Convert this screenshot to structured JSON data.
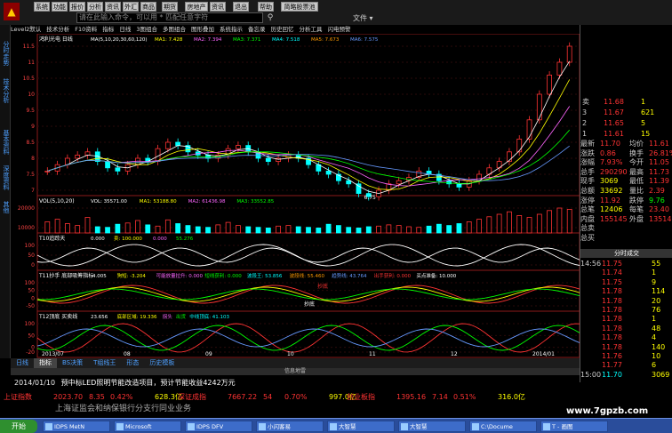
{
  "toolbar": {
    "buttons": [
      "系统",
      "功能",
      "报价",
      "分析",
      "资讯",
      "外汇",
      "商品",
      "期货",
      "房地产",
      "资讯",
      "退出",
      "帮助",
      "简略股票池"
    ],
    "search_placeholder": "请在此输入命令，可以用 * 匹配任意字符",
    "search_icon": "magnifier-icon",
    "file_menu": "文件 ▾"
  },
  "left_tabs": [
    "分时走势",
    "技术分析",
    "基本资料",
    "深度资料",
    "其他"
  ],
  "menu_bar": [
    "Level2默认",
    "技术分析",
    "F10资料",
    "指标",
    "日线",
    "3图组合",
    "多图组合",
    "图形叠加",
    "系统指示",
    "备忘录",
    "历史回忆",
    "分析工具",
    "闪电预警"
  ],
  "chart_data": [
    {
      "type": "line",
      "title": "鸿利光电 日线",
      "legend": [
        "MA(5,10,20,30,60,120)",
        "MA1: 7.428",
        "MA2: 7.394",
        "MA3: 7.371",
        "MA4: 7.518",
        "MA5: 7.673",
        "MA6: 7.575"
      ],
      "y_ticks": [
        11.5,
        11.0,
        10.5,
        10.0,
        9.5,
        9.0,
        8.5,
        8.0,
        7.5,
        7.0
      ],
      "annotations": [
        "6.75"
      ],
      "close": [
        7.6,
        7.8,
        8.0,
        8.1,
        8.2,
        7.9,
        7.7,
        7.6,
        7.8,
        8.0,
        7.9,
        8.3,
        8.5,
        8.4,
        8.2,
        8.1,
        8.0,
        8.1,
        8.3,
        8.4,
        8.2,
        8.0,
        7.9,
        8.0,
        8.1,
        8.0,
        7.8,
        7.6,
        7.5,
        7.3,
        7.2,
        6.9,
        6.8,
        7.0,
        7.2,
        7.3,
        7.4,
        7.6,
        7.5,
        7.3,
        7.2,
        7.1,
        7.3,
        7.5,
        7.7,
        7.9,
        8.2,
        8.6,
        9.2,
        10.0,
        10.6,
        11.0,
        11.5
      ]
    },
    {
      "type": "bar",
      "title": "VOL(5,10,20)",
      "legend": [
        "VOL: 35571.00",
        "MA1: 53188.80",
        "MA2: 61436.98",
        "MA3: 33552.85"
      ],
      "y_ticks": [
        20000,
        10000
      ],
      "values": [
        18,
        22,
        15,
        12,
        25,
        10,
        9,
        14,
        16,
        20,
        13,
        11,
        21,
        15,
        12,
        10,
        9,
        13,
        17,
        12,
        10,
        9,
        8,
        11,
        12,
        10,
        9,
        8,
        14,
        12,
        9,
        8,
        10,
        11,
        13,
        12,
        10,
        9,
        11,
        14,
        12,
        15,
        18,
        22,
        26,
        30,
        34,
        28,
        25,
        30,
        36,
        40,
        38
      ]
    },
    {
      "type": "line",
      "title": "T10追踪天",
      "legend": [
        "0.000",
        "卖: 100.000",
        "0.000",
        "55.276"
      ],
      "y_ticks": [
        100,
        50,
        0
      ]
    },
    {
      "type": "line",
      "title": "T11抄手 底部吸筹指标",
      "legend": [
        "-4.005",
        "狗短: -3.204",
        "可能放量拉升: 0.000",
        "短线获利: 0.000",
        "波段王: 53.856",
        "波段线: 55.460",
        "趋势线: 43.764",
        "出手获利: 0.000",
        "买点准备: 10.000"
      ],
      "y_ticks": [
        100,
        50,
        0,
        -50
      ],
      "annotations": [
        "抄底",
        "抄底"
      ]
    },
    {
      "type": "line",
      "title": "T12顶底 买卖线",
      "legend": [
        "23.656",
        "底部区域: 19.336",
        "拐头",
        "出货",
        "中线顶底: 41.103"
      ],
      "y_ticks": [
        100,
        50,
        0,
        -20
      ]
    }
  ],
  "x_axis_labels": [
    "2013/07",
    "08",
    "09",
    "10",
    "11",
    "12",
    "2014/01"
  ],
  "right_panel": {
    "ask_rows": [
      {
        "label": "卖",
        "price": "11.68",
        "vol": "1"
      },
      {
        "label": "3",
        "price": "11.67",
        "vol": "621"
      },
      {
        "label": "2",
        "price": "11.65",
        "vol": "5"
      },
      {
        "label": "1",
        "price": "11.61",
        "vol": "15"
      }
    ],
    "stats": [
      {
        "k1": "最新",
        "v1": "11.70",
        "k2": "均价",
        "v2": "11.61"
      },
      {
        "k1": "涨跌",
        "v1": "0.86",
        "k2": "换手",
        "v2": "26.81%"
      },
      {
        "k1": "涨幅",
        "v1": "7.93%",
        "k2": "今开",
        "v2": "11.05"
      },
      {
        "k1": "总手",
        "v1": "290290",
        "k2": "最高",
        "v2": "11.73"
      },
      {
        "k1": "现手",
        "v1": "3069",
        "k2": "最低",
        "v2": "11.39"
      },
      {
        "k1": "总额",
        "v1": "33692",
        "k2": "量比",
        "v2": "2.39"
      },
      {
        "k1": "涨停",
        "v1": "11.92",
        "k2": "跌停",
        "v2": "9.76"
      },
      {
        "k1": "总笔",
        "v1": "12406",
        "k2": "每笔",
        "v2": "23.40"
      },
      {
        "k1": "内盘",
        "v1": "155145",
        "k2": "外盘",
        "v2": "135145"
      },
      {
        "k1": "总卖",
        "v1": "",
        "k2": "",
        "v2": ""
      },
      {
        "k1": "总买",
        "v1": "",
        "k2": "",
        "v2": ""
      }
    ],
    "trades_title": "分时成交",
    "trades": [
      {
        "t": "14:56",
        "p": "11.75",
        "v": "55"
      },
      {
        "t": "",
        "p": "11.74",
        "v": "1"
      },
      {
        "t": "",
        "p": "11.75",
        "v": "9"
      },
      {
        "t": "",
        "p": "11.78",
        "v": "114"
      },
      {
        "t": "",
        "p": "11.78",
        "v": "20"
      },
      {
        "t": "",
        "p": "11.78",
        "v": "76"
      },
      {
        "t": "",
        "p": "11.78",
        "v": "1"
      },
      {
        "t": "",
        "p": "11.78",
        "v": "48"
      },
      {
        "t": "",
        "p": "11.78",
        "v": "4"
      },
      {
        "t": "",
        "p": "11.78",
        "v": "140"
      },
      {
        "t": "",
        "p": "11.76",
        "v": "10"
      },
      {
        "t": "",
        "p": "11.77",
        "v": "6"
      },
      {
        "t": "15:00",
        "p": "11.70",
        "v": "3069"
      }
    ]
  },
  "bottom_tabs": [
    "日线",
    "指标",
    "BS决策",
    "T组线王",
    "形态",
    "历史模板"
  ],
  "info_header": "信息地雷",
  "news": {
    "time": "2014/01/10",
    "title": "预中标LED照明节能改造项目，预计节能收益4242万元"
  },
  "index_bar": [
    {
      "name": "上证指数",
      "val": "2023.70",
      "chg": "8.35",
      "pct": "0.42%"
    },
    {
      "name": "深证成指",
      "val": "7667.22",
      "chg": "54",
      "pct": "0.70%"
    },
    {
      "name": "创业板指",
      "val": "1395.16",
      "chg": "7.14",
      "pct": "0.51%"
    }
  ],
  "index_extra": [
    "628.3亿",
    "997.0亿",
    "316.0亿"
  ],
  "ticker": "上海证监会和纳保银行分支行同业业务",
  "watermark": "www.7gpzb.com",
  "taskbar": {
    "start": "开始",
    "items": [
      "IDPS MetN",
      "Microsoft",
      "IDPS DFV",
      "小闪客易",
      "大智慧",
      "大智慧",
      "C:\\Docume",
      "T - 画图"
    ]
  },
  "colors": {
    "rise": "#ff3333",
    "fall": "#00ffff",
    "panel": "#000000",
    "accent": "#ffff00"
  }
}
